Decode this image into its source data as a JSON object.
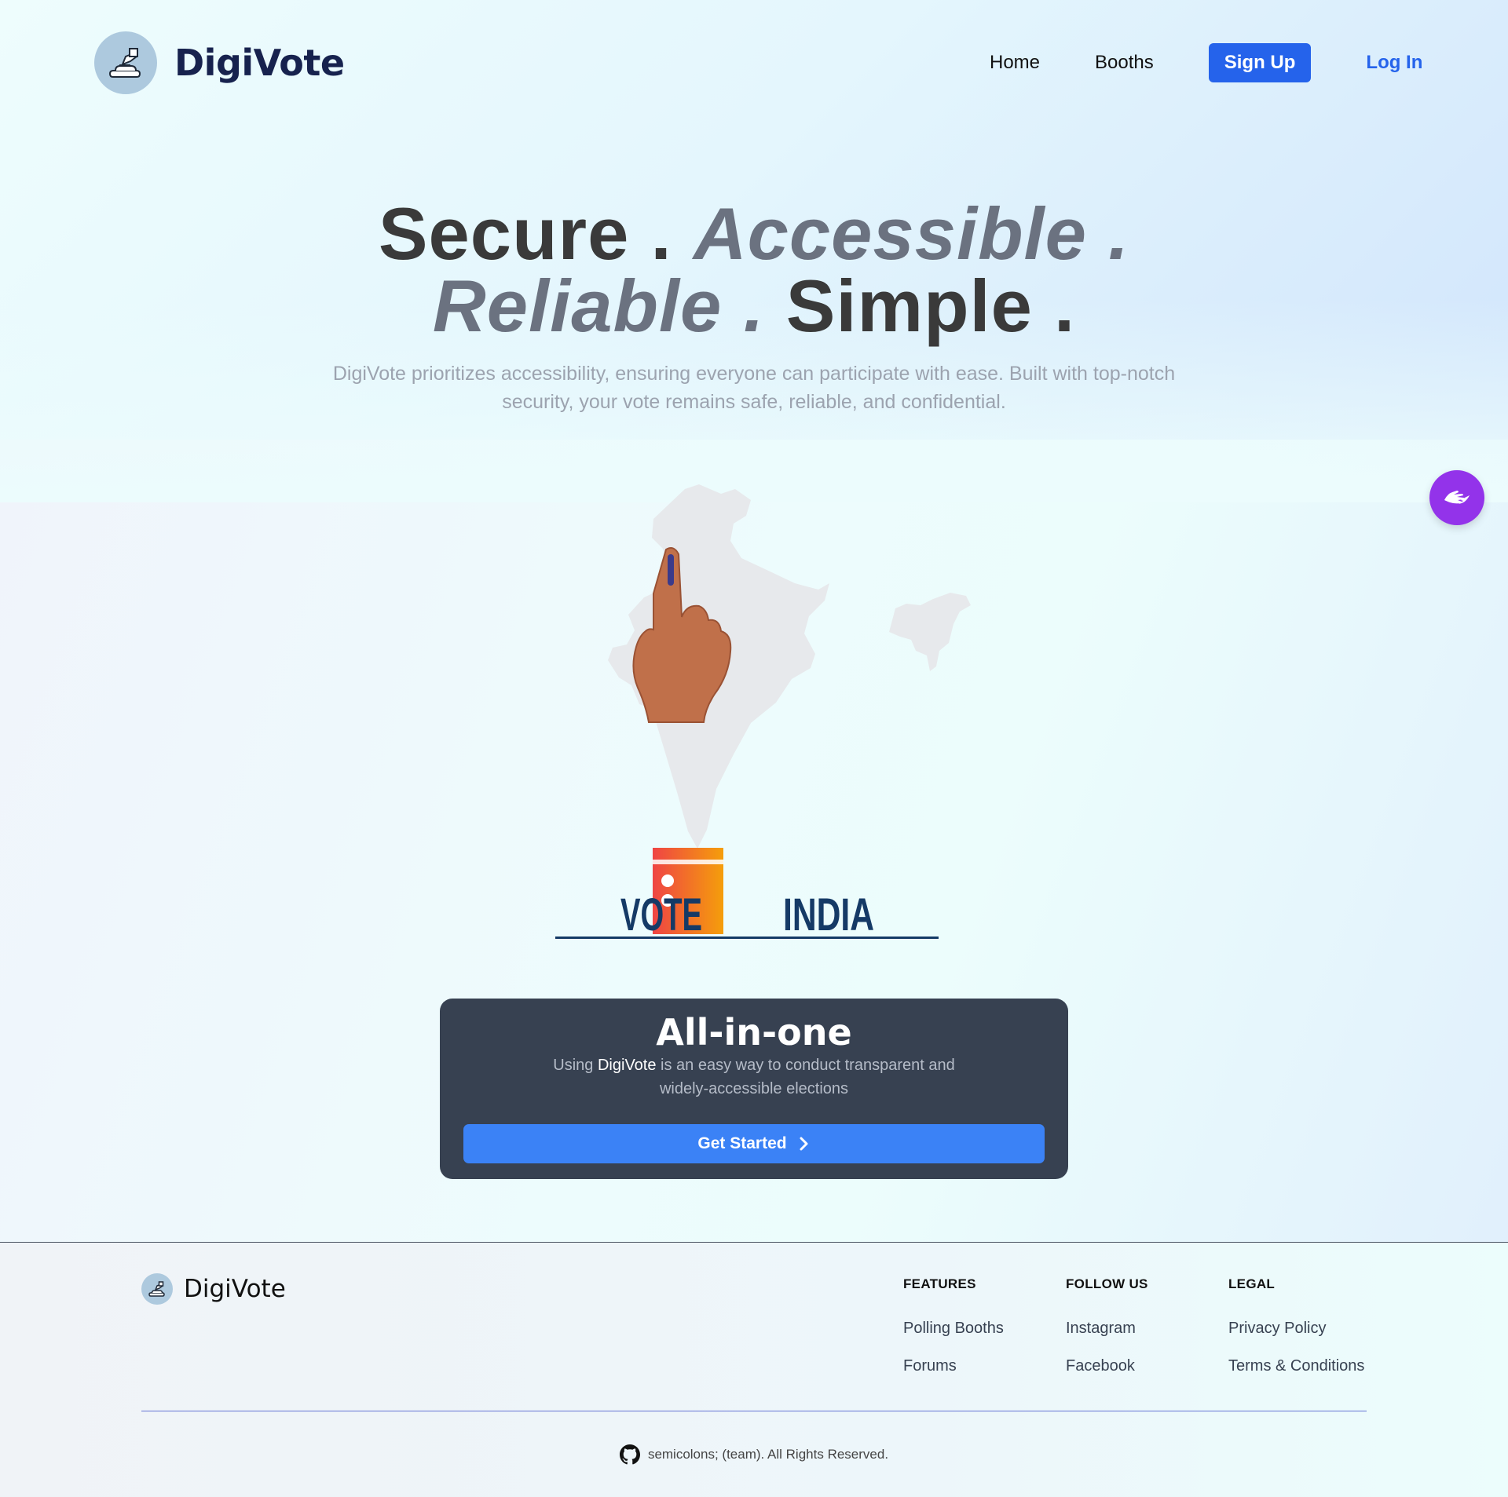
{
  "nav": {
    "brand": "DigiVote",
    "links": [
      "Home",
      "Booths"
    ],
    "signup": "Sign Up",
    "login": "Log In"
  },
  "hero": {
    "title_parts": [
      "Secure .",
      "Accessible .",
      "Reliable .",
      "Simple ."
    ],
    "subtitle": "DigiVote prioritizes accessibility, ensuring everyone can participate with ease. Built with top-notch security, your vote remains safe, reliable, and confidential."
  },
  "illustration": {
    "word_left": "VOTE",
    "word_right": "INDIA"
  },
  "card": {
    "title": "All-in-one",
    "desc_prefix": "Using ",
    "desc_brand": "DigiVote",
    "desc_suffix": " is an easy way to conduct transparent and widely-accessible elections",
    "cta": "Get Started"
  },
  "footer": {
    "brand": "DigiVote",
    "columns": [
      {
        "heading": "FEATURES",
        "items": [
          "Polling Booths",
          "Forums"
        ]
      },
      {
        "heading": "FOLLOW US",
        "items": [
          "Instagram",
          "Facebook"
        ]
      },
      {
        "heading": "LEGAL",
        "items": [
          "Privacy Policy",
          "Terms & Conditions"
        ]
      }
    ],
    "copyright": "semicolons; (team). All Rights Reserved."
  },
  "colors": {
    "primary": "#2563eb",
    "card_bg": "#374151",
    "accessibility_fab": "#9333ea",
    "brand_text": "#17224e"
  },
  "icons": [
    "ballot-box-logo-icon",
    "sign-language-icon",
    "chevron-right-icon",
    "github-icon"
  ]
}
